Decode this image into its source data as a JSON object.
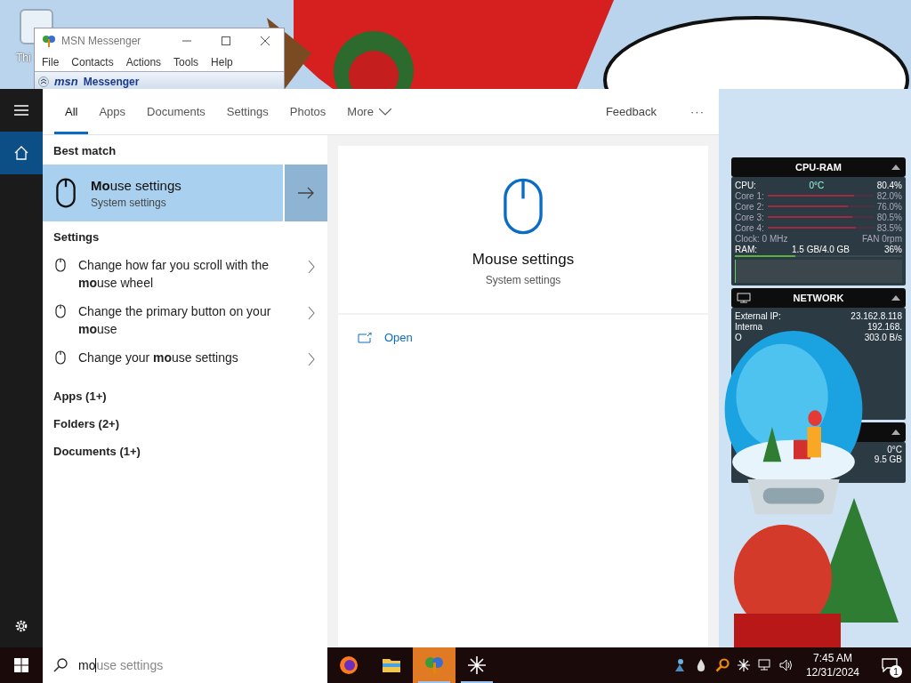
{
  "desktop": {
    "icon_label": "Thi"
  },
  "msn_window": {
    "title": "MSN Messenger",
    "menu": [
      "File",
      "Contacts",
      "Actions",
      "Tools",
      "Help"
    ],
    "banner_logo": "msn",
    "banner_title": "Messenger"
  },
  "search": {
    "tabs": [
      {
        "label": "All",
        "selected": true
      },
      {
        "label": "Apps",
        "selected": false
      },
      {
        "label": "Documents",
        "selected": false
      },
      {
        "label": "Settings",
        "selected": false
      },
      {
        "label": "Photos",
        "selected": false
      },
      {
        "label": "More",
        "selected": false
      }
    ],
    "feedback": "Feedback",
    "more_menu": "···",
    "best_match_heading": "Best match",
    "best_match": {
      "title": "**Mo**use settings",
      "subtitle": "System settings",
      "selected": true
    },
    "settings_heading": "Settings",
    "settings_items": [
      {
        "text": "Change how far you scroll with the **mo**use wheel"
      },
      {
        "text": "Change the primary button on your **mo**use"
      },
      {
        "text": "Change your **mo**use settings"
      }
    ],
    "groups": [
      "Apps (1+)",
      "Folders (2+)",
      "Documents (1+)"
    ],
    "preview": {
      "title": "Mouse settings",
      "subtitle": "System settings",
      "action": "Open"
    }
  },
  "taskbar": {
    "search": {
      "value": "mo",
      "suggestion": "use settings"
    },
    "apps": [
      {
        "kind": "firefox",
        "active": false,
        "open": false
      },
      {
        "kind": "folder",
        "active": false,
        "open": false
      },
      {
        "kind": "messenger",
        "active": true,
        "open": true
      },
      {
        "kind": "asterisk",
        "active": false,
        "open": true
      }
    ],
    "time": "7:45 AM",
    "date": "12/31/2024",
    "notifications": "1"
  },
  "gadgets": {
    "cpu": {
      "title": "CPU-RAM",
      "label": "CPU:",
      "temp": "0°C",
      "value": "80.4%",
      "cores": [
        {
          "name": "Core 1:",
          "value": "82.0%",
          "level": 0.82
        },
        {
          "name": "Core 2:",
          "value": "76.0%",
          "level": 0.76
        },
        {
          "name": "Core 3:",
          "value": "80.5%",
          "level": 0.805
        },
        {
          "name": "Core 4:",
          "value": "83.5%",
          "level": 0.835
        }
      ],
      "clock": "Clock: 0 MHz",
      "fan": "FAN 0rpm",
      "ram_label": "RAM:",
      "ram_amount": "1.5 GB/4.0 GB",
      "ram_value": "36%",
      "level": 0.36
    },
    "network": {
      "title": "NETWORK",
      "rows": [
        {
          "label": "External IP:",
          "value": "23.162.8.118"
        },
        {
          "label": "Interna",
          "value": "192.168."
        },
        {
          "label": "O",
          "value": "303.0 B/s"
        }
      ]
    },
    "third": {
      "temp": "0°C",
      "value": "9.5 GB"
    }
  }
}
